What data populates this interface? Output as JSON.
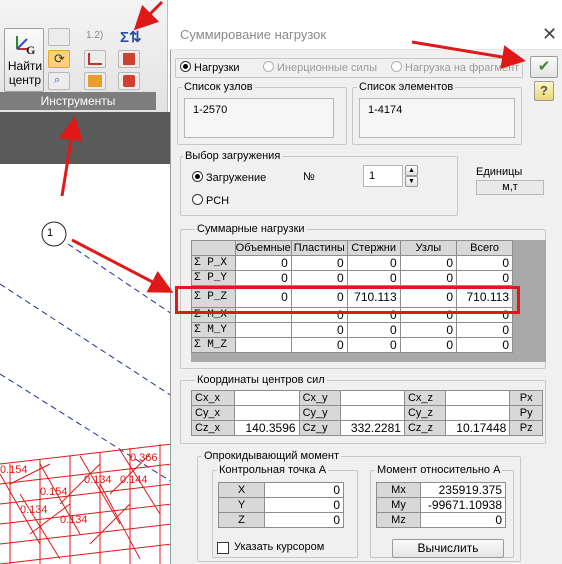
{
  "toolbar": {
    "find_label_line1": "Найти",
    "find_label_line2": "центр",
    "group_caption": "Инструменты",
    "dropdown_value": "1.2)"
  },
  "drawing": {
    "node_marker": "1",
    "labels": [
      "0.366",
      "0.154",
      "0.144",
      "0.154",
      "0.134",
      "0.134",
      "0.134"
    ]
  },
  "dialog": {
    "title": "Суммирование нагрузок",
    "close_label": "✕",
    "modes": [
      {
        "label": "Нагрузки",
        "selected": true,
        "enabled": true
      },
      {
        "label": "Инерционные силы",
        "selected": false,
        "enabled": false
      },
      {
        "label": "Нагрузка на фрагмент",
        "selected": false,
        "enabled": false
      }
    ],
    "ok_label": "✔",
    "help_label": "?",
    "nodes": {
      "title": "Список узлов",
      "value": "1-2570"
    },
    "elements": {
      "title": "Список элементов",
      "value": "1-4174"
    },
    "load_select": {
      "title": "Выбор загружения",
      "option_load": "Загружение",
      "option_rsn": "РСН",
      "number_label": "№",
      "number_value": "1"
    },
    "units": {
      "title": "Единицы",
      "value": "м,т"
    },
    "sums": {
      "title": "Суммарные нагрузки",
      "columns": [
        "Объемные",
        "Пластины",
        "Стержни",
        "Узлы",
        "Всего"
      ],
      "rows": [
        {
          "label": "Σ P_X",
          "values": [
            "0",
            "0",
            "0",
            "0",
            "0"
          ]
        },
        {
          "label": "Σ P_Y",
          "values": [
            "0",
            "0",
            "0",
            "0",
            "0"
          ]
        },
        {
          "label": "Σ P_Z",
          "values": [
            "0",
            "0",
            "710.113",
            "0",
            "710.113"
          ]
        },
        {
          "label": "Σ M_X",
          "values": [
            "",
            "0",
            "0",
            "0",
            "0"
          ]
        },
        {
          "label": "Σ M_Y",
          "values": [
            "",
            "0",
            "0",
            "0",
            "0"
          ]
        },
        {
          "label": "Σ M_Z",
          "values": [
            "",
            "0",
            "0",
            "0",
            "0"
          ]
        }
      ]
    },
    "centers": {
      "title": "Координаты центров сил",
      "rows": [
        {
          "a": "Cx_x",
          "av": "",
          "b": "Cx_y",
          "bv": "",
          "c": "Cx_z",
          "cv": "",
          "d": "Px"
        },
        {
          "a": "Cy_x",
          "av": "",
          "b": "Cy_y",
          "bv": "",
          "c": "Cy_z",
          "cv": "",
          "d": "Py"
        },
        {
          "a": "Cz_x",
          "av": "140.3596",
          "b": "Cz_y",
          "bv": "332.2281",
          "c": "Cz_z",
          "cv": "10.17448",
          "d": "Pz"
        }
      ]
    },
    "overturn": {
      "title": "Опрокидывающий момент",
      "point": {
        "title": "Контрольная точка А",
        "rows": [
          {
            "label": "X",
            "value": "0"
          },
          {
            "label": "Y",
            "value": "0"
          },
          {
            "label": "Z",
            "value": "0"
          }
        ],
        "cursor_label": "Указать курсором"
      },
      "moment": {
        "title": "Момент относительно А",
        "rows": [
          {
            "label": "Mx",
            "value": "235919.375"
          },
          {
            "label": "My",
            "value": "-99671.10938"
          },
          {
            "label": "Mz",
            "value": "0"
          }
        ],
        "calc_label": "Вычислить"
      }
    }
  }
}
